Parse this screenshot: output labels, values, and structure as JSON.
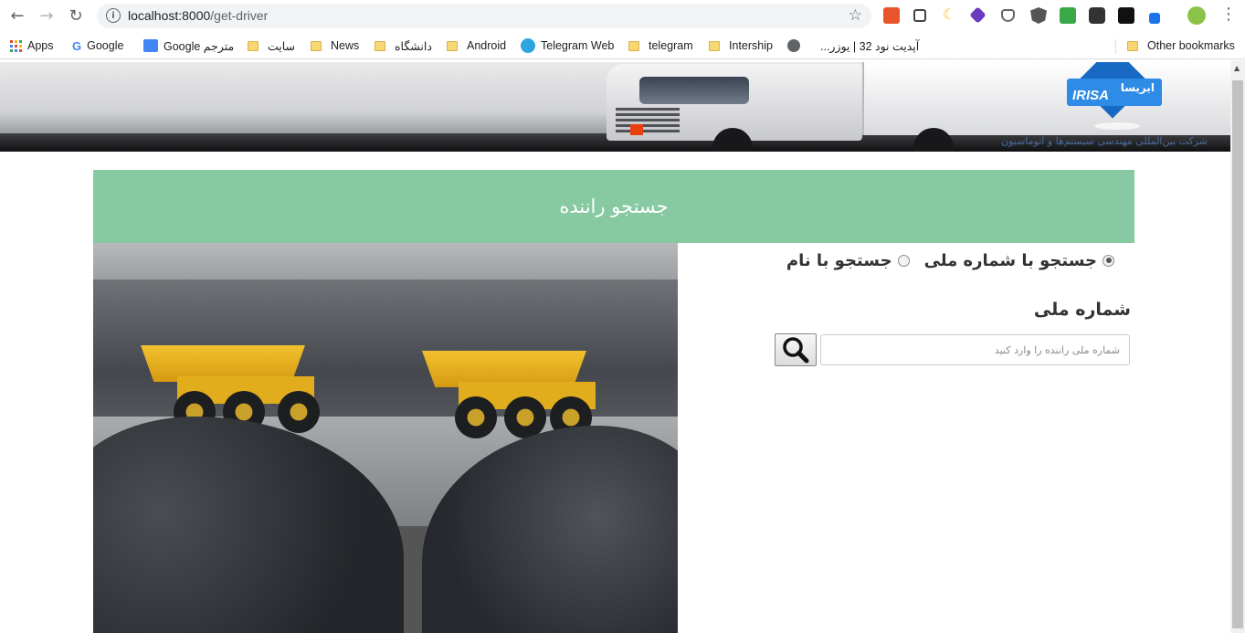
{
  "browser": {
    "url_host": "localhost:8000",
    "url_path": "/get-driver",
    "bookmarks": [
      {
        "label": "Apps",
        "icon": "apps-grid-icon"
      },
      {
        "label": "Google",
        "icon": "google-icon"
      },
      {
        "label": "Google مترجم",
        "icon": "google-translate-icon"
      },
      {
        "label": "سایت",
        "icon": "folder-icon"
      },
      {
        "label": "News",
        "icon": "folder-icon"
      },
      {
        "label": "دانشگاه",
        "icon": "folder-icon"
      },
      {
        "label": "Android",
        "icon": "folder-icon"
      },
      {
        "label": "Telegram Web",
        "icon": "telegram-icon"
      },
      {
        "label": "telegram",
        "icon": "folder-icon"
      },
      {
        "label": "Intership",
        "icon": "folder-icon"
      },
      {
        "label": "",
        "icon": "globe-icon"
      },
      {
        "label": "آپدیت نود 32 | یوزر...",
        "icon": "folder-icon"
      },
      {
        "label": "Other bookmarks",
        "icon": "folder-icon"
      }
    ]
  },
  "banner": {
    "logo_en": "IRISA",
    "logo_fa": "ایریسا",
    "tagline": "شرکت بین‌المللی مهندسی سیستم‌ها و اتوماسیون"
  },
  "page": {
    "title": "جستجو راننده",
    "search_modes": [
      {
        "label": "جستجو با شماره ملی",
        "selected": true
      },
      {
        "label": "جستجو با نام",
        "selected": false
      }
    ],
    "field_label": "شماره ملی",
    "input_placeholder": "شماره ملی راننده را وارد کنید",
    "input_value": ""
  },
  "colors": {
    "header_green": "#87c9a0",
    "logo_blue": "#2e8be6"
  }
}
